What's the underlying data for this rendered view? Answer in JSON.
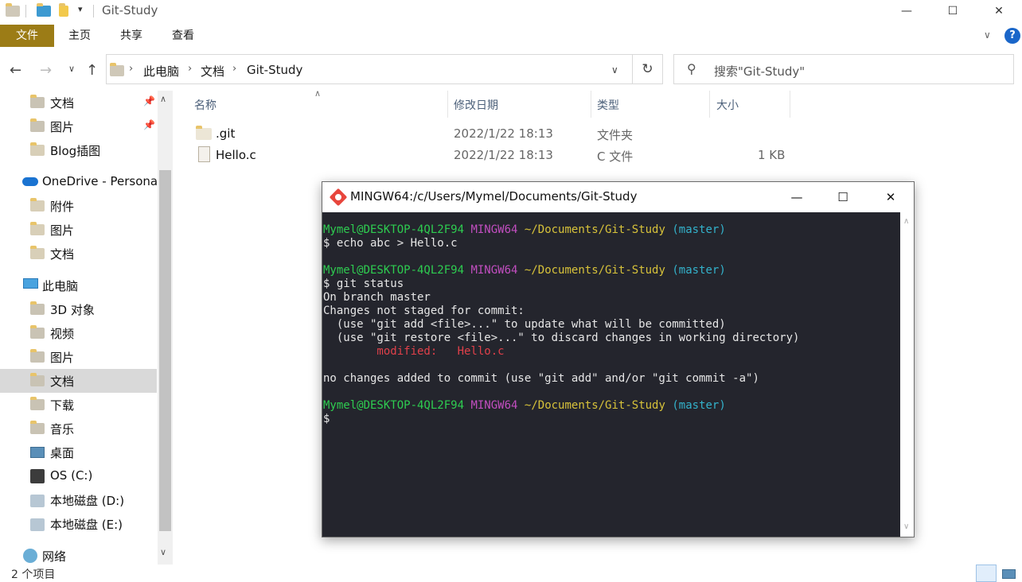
{
  "window": {
    "title": "Git-Study",
    "controls": {
      "minimize": "—",
      "maximize": "☐",
      "close": "✕"
    }
  },
  "ribbon": {
    "tabs": [
      "文件",
      "主页",
      "共享",
      "查看"
    ],
    "expand_glyph": "∨",
    "help_glyph": "?"
  },
  "nav": {
    "breadcrumbs": [
      "此电脑",
      "文档",
      "Git-Study"
    ],
    "search_placeholder": "搜索\"Git-Study\""
  },
  "sidebar": {
    "items": [
      {
        "label": "文档",
        "icon": "documents-folder-icon",
        "pinned": true
      },
      {
        "label": "图片",
        "icon": "pictures-folder-icon",
        "pinned": true
      },
      {
        "label": "Blog插图",
        "icon": "folder-icon",
        "pinned": false
      },
      {
        "label": "OneDrive - Personal",
        "icon": "onedrive-cloud-icon",
        "pinned": false
      },
      {
        "label": "附件",
        "icon": "folder-icon",
        "pinned": false
      },
      {
        "label": "图片",
        "icon": "folder-icon",
        "pinned": false
      },
      {
        "label": "文档",
        "icon": "folder-icon",
        "pinned": false
      },
      {
        "label": "此电脑",
        "icon": "this-pc-icon",
        "pinned": false
      },
      {
        "label": "3D 对象",
        "icon": "3d-objects-icon",
        "pinned": false
      },
      {
        "label": "视频",
        "icon": "videos-folder-icon",
        "pinned": false
      },
      {
        "label": "图片",
        "icon": "pictures-folder-icon",
        "pinned": false
      },
      {
        "label": "文档",
        "icon": "documents-folder-icon",
        "pinned": false,
        "selected": true
      },
      {
        "label": "下载",
        "icon": "downloads-folder-icon",
        "pinned": false
      },
      {
        "label": "音乐",
        "icon": "music-folder-icon",
        "pinned": false
      },
      {
        "label": "桌面",
        "icon": "desktop-folder-icon",
        "pinned": false
      },
      {
        "label": "OS (C:)",
        "icon": "windows-drive-icon",
        "pinned": false
      },
      {
        "label": "本地磁盘 (D:)",
        "icon": "drive-icon",
        "pinned": false
      },
      {
        "label": "本地磁盘 (E:)",
        "icon": "drive-icon",
        "pinned": false
      },
      {
        "label": "网络",
        "icon": "network-icon",
        "pinned": false
      }
    ]
  },
  "files": {
    "columns": [
      "名称",
      "修改日期",
      "类型",
      "大小"
    ],
    "rows": [
      {
        "name": ".git",
        "modified": "2022/1/22 18:13",
        "type": "文件夹",
        "size": ""
      },
      {
        "name": "Hello.c",
        "modified": "2022/1/22 18:13",
        "type": "C 文件",
        "size": "1 KB"
      }
    ]
  },
  "status": {
    "item_count": "2 个项目"
  },
  "terminal": {
    "title": "MINGW64:/c/Users/Mymel/Documents/Git-Study",
    "controls": {
      "minimize": "—",
      "maximize": "☐",
      "close": "✕"
    },
    "prompt": {
      "user_host": "Mymel@DESKTOP-4QL2F94",
      "env": "MINGW64",
      "path": "~/Documents/Git-Study",
      "branch": "(master)"
    },
    "commands": [
      "$ echo abc > Hello.c",
      "$ git status"
    ],
    "output": [
      "On branch master",
      "Changes not staged for commit:",
      "  (use \"git add <file>...\" to update what will be committed)",
      "  (use \"git restore <file>...\" to discard changes in working directory)"
    ],
    "modified_label": "        modified:   Hello.c",
    "summary": "no changes added to commit (use \"git add\" and/or \"git commit -a\")",
    "cursor_prompt": "$"
  },
  "colors": {
    "file_tab_bg": "#9c7c16",
    "terminal_bg": "#24252d",
    "prompt_green": "#2ecc50",
    "prompt_magenta": "#c24ec0",
    "prompt_yellow": "#d7c23a",
    "prompt_cyan": "#33b3cc",
    "modified_red": "#e0404a"
  }
}
